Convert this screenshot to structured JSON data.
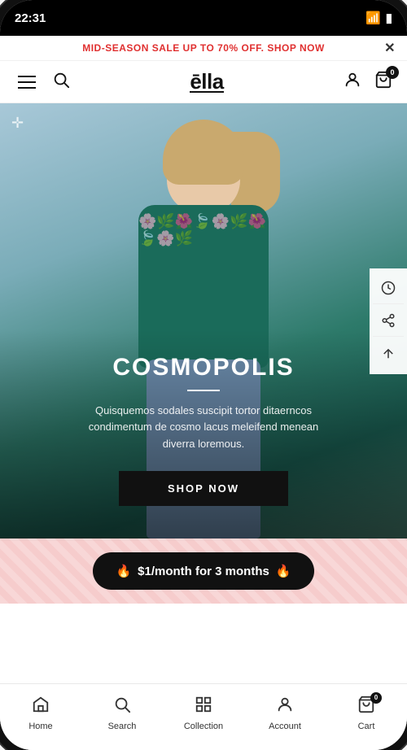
{
  "status": {
    "time": "22:31",
    "wifi": "📶",
    "battery": "🔋"
  },
  "promo_banner": {
    "text": "MID-SEASON SALE UP TO 70% OFF. SHOP NOW",
    "close_label": "✕"
  },
  "header": {
    "logo": "ēlla",
    "cart_count": "0"
  },
  "hero": {
    "title": "COSMOPOLIS",
    "description": "Quisquemos sodales suscipit tortor ditaerncos condimentum de cosmo lacus meleifend menean diverra loremous.",
    "cta_label": "SHOP NOW"
  },
  "side_actions": [
    {
      "icon": "🕐",
      "name": "history"
    },
    {
      "icon": "⎆",
      "name": "share"
    },
    {
      "icon": "↑",
      "name": "scroll-up"
    }
  ],
  "promo_strip": {
    "text": "$1/month for 3 months",
    "fire_emoji": "🔥"
  },
  "bottom_nav": [
    {
      "label": "Home",
      "icon": "⌂",
      "name": "home"
    },
    {
      "label": "Search",
      "icon": "⌕",
      "name": "search"
    },
    {
      "label": "Collection",
      "icon": "⊞",
      "name": "collection"
    },
    {
      "label": "Account",
      "icon": "◯",
      "name": "account"
    },
    {
      "label": "Cart",
      "icon": "⊡",
      "name": "cart",
      "badge": "0"
    }
  ]
}
